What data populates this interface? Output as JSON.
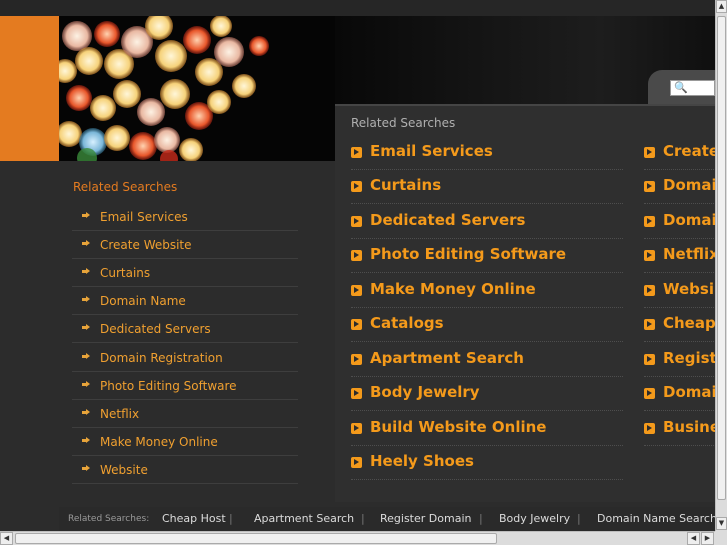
{
  "header": {
    "search_icon": "magnifier-icon",
    "colors": {
      "accent": "#f49a1b",
      "sidebar_accent": "#e47b20",
      "background": "#2c2c2c"
    }
  },
  "main": {
    "title": "Related Searches",
    "left_column": [
      "Email Services",
      "Curtains",
      "Dedicated Servers",
      "Photo Editing Software",
      "Make Money Online",
      "Catalogs",
      "Apartment Search",
      "Body Jewelry",
      "Build Website Online",
      "Heely Shoes"
    ],
    "right_column": [
      "Create",
      "Domai",
      "Domai",
      "Netflix",
      "Websi",
      "Cheap",
      "Regist",
      "Domai",
      "Busine"
    ]
  },
  "sidebar": {
    "title": "Related Searches",
    "items": [
      "Email Services",
      "Create Website",
      "Curtains",
      "Domain Name",
      "Dedicated Servers",
      "Domain Registration",
      "Photo Editing Software",
      "Netflix",
      "Make Money Online",
      "Website"
    ]
  },
  "footer": {
    "label": "Related Searches:",
    "items": [
      "Cheap Host",
      "Apartment Search",
      "Register Domain",
      "Body Jewelry",
      "Domain Name Search"
    ],
    "separator": "|"
  }
}
